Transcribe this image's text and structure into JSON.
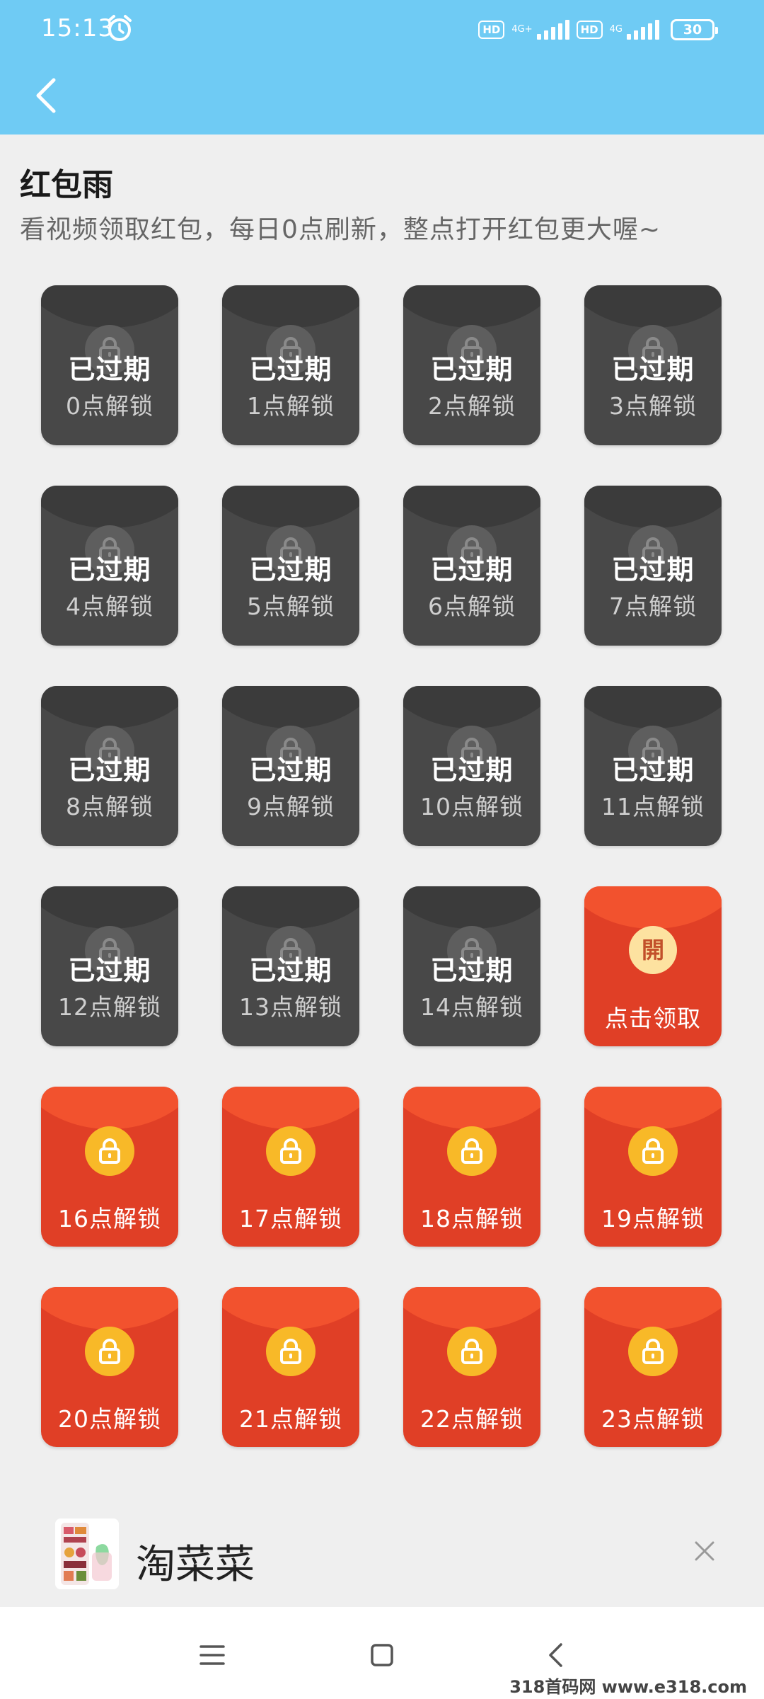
{
  "status_bar": {
    "time": "15:13",
    "alarm_icon": "alarm-clock-icon",
    "sim1": {
      "badge": "HD",
      "network": "4G+"
    },
    "sim2": {
      "badge": "HD",
      "network": "4G"
    },
    "battery": "30"
  },
  "navbar": {
    "back_icon": "chevron-left-icon"
  },
  "page": {
    "title": "红包雨",
    "subtitle": "看视频领取红包，每日0点刷新，整点打开红包更大喔~"
  },
  "envelopes": [
    {
      "state": "expired",
      "status": "已过期",
      "label": "0点解锁"
    },
    {
      "state": "expired",
      "status": "已过期",
      "label": "1点解锁"
    },
    {
      "state": "expired",
      "status": "已过期",
      "label": "2点解锁"
    },
    {
      "state": "expired",
      "status": "已过期",
      "label": "3点解锁"
    },
    {
      "state": "expired",
      "status": "已过期",
      "label": "4点解锁"
    },
    {
      "state": "expired",
      "status": "已过期",
      "label": "5点解锁"
    },
    {
      "state": "expired",
      "status": "已过期",
      "label": "6点解锁"
    },
    {
      "state": "expired",
      "status": "已过期",
      "label": "7点解锁"
    },
    {
      "state": "expired",
      "status": "已过期",
      "label": "8点解锁"
    },
    {
      "state": "expired",
      "status": "已过期",
      "label": "9点解锁"
    },
    {
      "state": "expired",
      "status": "已过期",
      "label": "10点解锁"
    },
    {
      "state": "expired",
      "status": "已过期",
      "label": "11点解锁"
    },
    {
      "state": "expired",
      "status": "已过期",
      "label": "12点解锁"
    },
    {
      "state": "expired",
      "status": "已过期",
      "label": "13点解锁"
    },
    {
      "state": "expired",
      "status": "已过期",
      "label": "14点解锁"
    },
    {
      "state": "claim",
      "glyph": "開",
      "label": "点击领取"
    },
    {
      "state": "locked",
      "label": "16点解锁"
    },
    {
      "state": "locked",
      "label": "17点解锁"
    },
    {
      "state": "locked",
      "label": "18点解锁"
    },
    {
      "state": "locked",
      "label": "19点解锁"
    },
    {
      "state": "locked",
      "label": "20点解锁"
    },
    {
      "state": "locked",
      "label": "21点解锁"
    },
    {
      "state": "locked",
      "label": "22点解锁"
    },
    {
      "state": "locked",
      "label": "23点解锁"
    }
  ],
  "ad": {
    "title": "淘菜菜",
    "close_icon": "close-icon"
  },
  "system_nav": {
    "menu_icon": "menu-icon",
    "home_icon": "home-square-icon",
    "back_icon": "back-triangle-icon"
  },
  "watermark": "318首码网 www.e318.com",
  "colors": {
    "header_blue": "#6fcbf4",
    "expired_gray": "#484848",
    "envelope_red": "#e03f26",
    "lock_gold": "#f8b928"
  }
}
